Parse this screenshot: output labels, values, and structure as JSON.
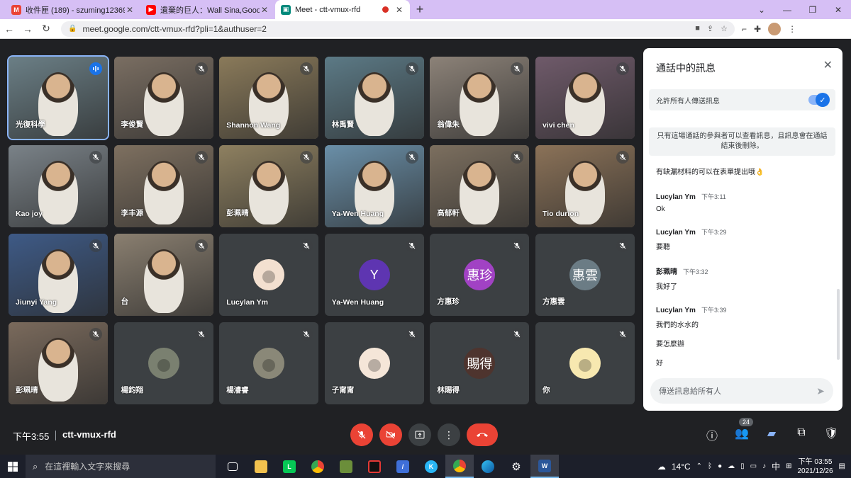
{
  "browser": {
    "tabs": [
      {
        "label": "收件匣 (189) - szuming12369@",
        "icon": "gmail-icon",
        "color": "#ea4335",
        "letter": "M",
        "active": false
      },
      {
        "label": "遺棄的巨人：Wall Sina,Goodby",
        "icon": "youtube-icon",
        "color": "#ff0000",
        "letter": "▶",
        "active": false
      },
      {
        "label": "Meet - ctt-vmux-rfd",
        "icon": "meet-icon",
        "color": "#00897b",
        "letter": "▣",
        "active": true
      }
    ],
    "url": "meet.google.com/ctt-vmux-rfd?pli=1&authuser=2"
  },
  "tiles": [
    {
      "name": "光復科學",
      "avatar": null,
      "speaking": true,
      "bg": "#6b7f86"
    },
    {
      "name": "李俊賢",
      "avatar": null,
      "speaking": false,
      "bg": "#7a6e62"
    },
    {
      "name": "Shannon Wang",
      "avatar": null,
      "speaking": false,
      "bg": "#8a7a5a"
    },
    {
      "name": "林禹賢",
      "avatar": null,
      "speaking": false,
      "bg": "#5c7a86"
    },
    {
      "name": "翁偉朱",
      "avatar": null,
      "speaking": false,
      "bg": "#8c8278"
    },
    {
      "name": "vivi chen",
      "avatar": null,
      "speaking": false,
      "bg": "#6f5a6a"
    },
    {
      "name": "Kao joy",
      "avatar": null,
      "speaking": false,
      "bg": "#7a8288"
    },
    {
      "name": "李丰源",
      "avatar": null,
      "speaking": false,
      "bg": "#7e7060"
    },
    {
      "name": "彭珮晴",
      "avatar": null,
      "speaking": false,
      "bg": "#8e8060"
    },
    {
      "name": "Ya-Wen Huang",
      "avatar": null,
      "speaking": false,
      "bg": "#6a8fa8"
    },
    {
      "name": "高郁軒",
      "avatar": null,
      "speaking": false,
      "bg": "#7c6f5f"
    },
    {
      "name": "Tio durion",
      "avatar": null,
      "speaking": false,
      "bg": "#8b7258"
    },
    {
      "name": "Jiunyi Yang",
      "avatar": null,
      "speaking": false,
      "bg": "#3e5a86"
    },
    {
      "name": "台",
      "avatar": null,
      "speaking": false,
      "bg": "#8a7f70"
    },
    {
      "name": "Lucylan Ym",
      "avatar": {
        "type": "photo",
        "color": "#f3e0d0"
      },
      "speaking": false,
      "bg": "#3c4043"
    },
    {
      "name": "Ya-Wen Huang",
      "avatar": {
        "type": "letter",
        "text": "Y",
        "color": "#5e35b1"
      },
      "speaking": false,
      "bg": "#3c4043"
    },
    {
      "name": "方惠珍",
      "avatar": {
        "type": "letter",
        "text": "惠珍",
        "color": "#a142c4"
      },
      "speaking": false,
      "bg": "#3c4043"
    },
    {
      "name": "方惠雲",
      "avatar": {
        "type": "letter",
        "text": "惠雲",
        "color": "#6b7c85"
      },
      "speaking": false,
      "bg": "#3c4043"
    },
    {
      "name": "彭珮晴",
      "avatar": null,
      "speaking": false,
      "bg": "#7a6a5c"
    },
    {
      "name": "楊鈞翔",
      "avatar": {
        "type": "photo",
        "color": "#7a8070"
      },
      "speaking": false,
      "bg": "#3c4043"
    },
    {
      "name": "楊濬睿",
      "avatar": {
        "type": "photo",
        "color": "#8a8878"
      },
      "speaking": false,
      "bg": "#3c4043"
    },
    {
      "name": "子甯甯",
      "avatar": {
        "type": "photo",
        "color": "#f5e6d8"
      },
      "speaking": false,
      "bg": "#3c4043"
    },
    {
      "name": "林賜得",
      "avatar": {
        "type": "letter",
        "text": "賜得",
        "color": "#4e342e"
      },
      "speaking": false,
      "bg": "#3c4043"
    },
    {
      "name": "你",
      "avatar": {
        "type": "photo",
        "color": "#f7e8b0"
      },
      "speaking": false,
      "bg": "#3c4043"
    }
  ],
  "chat": {
    "title": "通話中的訊息",
    "allow_label": "允許所有人傳送訊息",
    "notice": "只有這場通話的參與者可以查看訊息，且訊息會在通話結束後刪除。",
    "messages": [
      {
        "sender": "",
        "time": "",
        "lines": [
          "有缺漏材料的可以在表單提出哦👌"
        ]
      },
      {
        "sender": "Lucylan Ym",
        "time": "下午3:11",
        "lines": [
          "Ok"
        ]
      },
      {
        "sender": "Lucylan Ym",
        "time": "下午3:29",
        "lines": [
          "要聽"
        ]
      },
      {
        "sender": "彭珮晴",
        "time": "下午3:32",
        "lines": [
          "我好了"
        ]
      },
      {
        "sender": "Lucylan Ym",
        "time": "下午3:39",
        "lines": [
          "我們的水水的",
          "要怎麼辦",
          "好"
        ]
      }
    ],
    "input_placeholder": "傳送訊息給所有人"
  },
  "meetbar": {
    "time": "下午3:55",
    "code": "ctt-vmux-rfd",
    "participant_count": "24"
  },
  "taskbar": {
    "search_placeholder": "在這裡輸入文字來搜尋",
    "temp": "14°C",
    "ime": "中",
    "time": "下午 03:55",
    "date": "2021/12/26"
  }
}
